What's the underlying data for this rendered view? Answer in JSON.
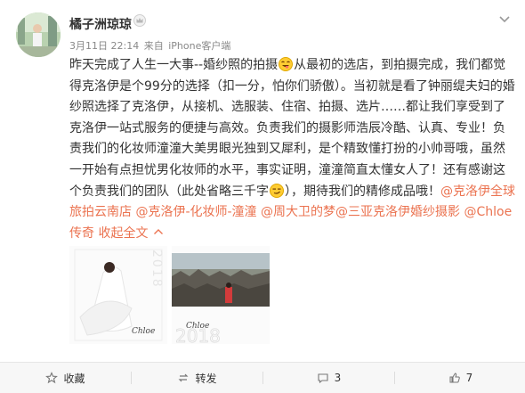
{
  "post": {
    "username": "橘子洲琼琼",
    "time": "3月11日 22:14",
    "source_prefix": "来自",
    "source": "iPhone客户端",
    "text_1": "昨天完成了人生一大事--婚纱照的拍摄",
    "text_2": "从最初的选店，到拍摄完成，我们都觉得克洛伊是个99分的选择（扣一分，怕你们骄傲）。当初就是看了钟丽缇夫妇的婚纱照选择了克洛伊，从接机、选服装、住宿、拍摄、选片……都让我们享受到了克洛伊一站式服务的便捷与高效。负责我们的摄影师浩辰冷酷、认真、专业！负责我们的化妆师潼潼大美男眼光独到又犀利，是个精致懂打扮的小帅哥哦，虽然一开始有点担忧男化妆师的水平，事实证明，潼潼简直太懂女人了！还有感谢这个负责我们的团队（此处省略三千字",
    "text_3": "），期待我们的精修成品哦！",
    "mentions": [
      "@克洛伊全球旅拍云南店",
      "@克洛伊-化妆师-潼潼",
      "@周大卫的梦",
      "@三亚克洛伊婚纱摄影",
      "@Chloe传奇"
    ],
    "collapse_label": "收起全文",
    "emoji_1": "grinning-tongue-emoji",
    "emoji_2": "smirk-emoji"
  },
  "images": [
    {
      "year": "2018",
      "alt": "wedding-photo-bride-white-dress"
    },
    {
      "year": "2018",
      "alt": "wedding-photo-old-town-rooftops"
    }
  ],
  "footer": {
    "favorite_label": "收藏",
    "repost_label": "转发",
    "comment_count": "3",
    "like_count": "7"
  },
  "colors": {
    "link": "#eb7350",
    "text": "#333333",
    "meta": "#888888",
    "footer_bg": "#f7f7f7"
  }
}
